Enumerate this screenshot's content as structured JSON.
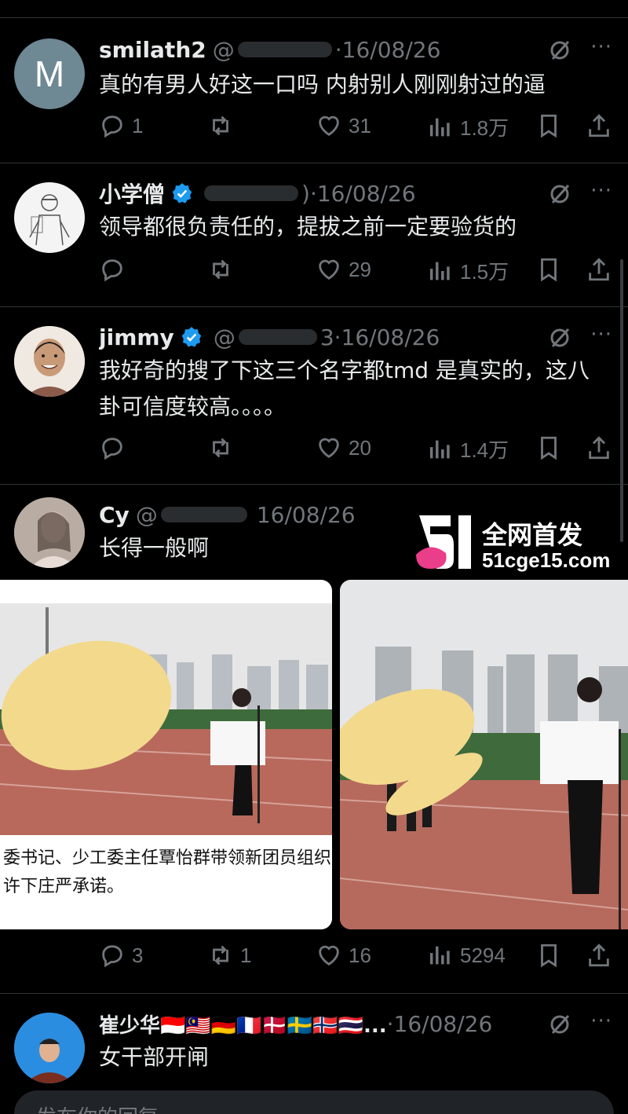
{
  "posts": [
    {
      "name": "smilath2",
      "handle_prefix": "@",
      "handle_suffix": "",
      "date": "·16/08/26",
      "text": "真的有男人好这一口吗 内射别人刚刚射过的逼",
      "avatar_letter": "M",
      "verified": false,
      "stats": {
        "replies": "1",
        "reposts": "",
        "likes": "31",
        "views": "1.8万"
      }
    },
    {
      "name": "小学僧",
      "handle_prefix": "",
      "handle_suffix": ")",
      "date": "·16/08/26",
      "text": "领导都很负责任的，提拔之前一定要验货的",
      "verified": true,
      "stats": {
        "replies": "",
        "reposts": "",
        "likes": "29",
        "views": "1.5万"
      }
    },
    {
      "name": "jimmy",
      "handle_prefix": "@",
      "handle_suffix": "3",
      "date": "·16/08/26",
      "text": "我好奇的搜了下这三个名字都tmd 是真实的，这八卦可信度较高。。。。",
      "verified": true,
      "stats": {
        "replies": "",
        "reposts": "",
        "likes": "20",
        "views": "1.4万"
      }
    },
    {
      "name": "Cy",
      "handle_prefix": "@",
      "handle_suffix": "",
      "date": "16/08/26",
      "text": "长得一般啊",
      "verified": false,
      "stats": {
        "replies": "3",
        "reposts": "1",
        "likes": "16",
        "views": "5294"
      }
    },
    {
      "name": "崔少华🇮🇩🇲🇾🇩🇪🇫🇷🇩🇰🇸🇪🇳🇴🇹🇭...",
      "handle_prefix": "",
      "handle_suffix": "",
      "date": "·16/08/26",
      "text": "女干部开闸",
      "verified": false
    }
  ],
  "photo_caption": "委书记、少工委主任覃怡群带领新团员组织许下庄严承诺。",
  "watermark": {
    "line1": "全网首发",
    "line2": "51cge15.com",
    "logo": "51"
  },
  "more_label": "···",
  "reply_placeholder": "发布你的回复",
  "colors": {
    "background": "#000000",
    "text": "#e7e9ea",
    "muted": "#71767b",
    "verified": "#1d9bf0",
    "divider": "#2f3336"
  },
  "icons": [
    "reply-icon",
    "repost-icon",
    "like-icon",
    "views-icon",
    "bookmark-icon",
    "share-icon",
    "grok-icon",
    "verified-icon"
  ]
}
